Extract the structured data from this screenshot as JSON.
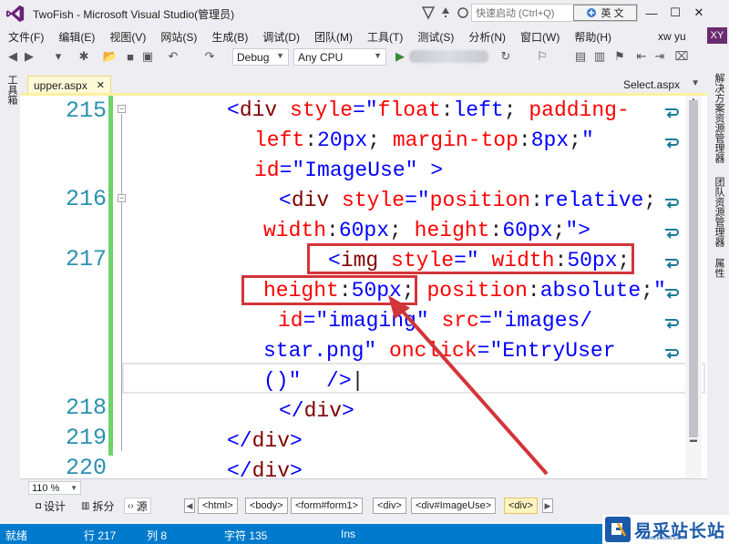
{
  "window": {
    "title": "TwoFish - Microsoft Visual Studio(管理员)",
    "quick_launch_placeholder": "快速启动 (Ctrl+Q)",
    "ime_label": "英 文"
  },
  "menu": [
    "文件(F)",
    "编辑(E)",
    "视图(V)",
    "网站(S)",
    "生成(B)",
    "调试(D)",
    "团队(M)",
    "工具(T)",
    "测试(S)",
    "分析(N)",
    "窗口(W)",
    "帮助(H)"
  ],
  "user": {
    "name": "xw yu",
    "initials": "XY"
  },
  "toolbar": {
    "config": "Debug",
    "platform": "Any CPU"
  },
  "left_panel": {
    "toolbox_label": "工具箱"
  },
  "right_panel": {
    "tabs": [
      "解决方案资源管理器",
      "团队资源管理器",
      "属性"
    ]
  },
  "tabs": {
    "active": "upper.aspx",
    "close_glyph": "✕",
    "preview": "Select.aspx"
  },
  "editor": {
    "line_numbers": [
      "215",
      "216",
      "217",
      "218",
      "219",
      "220"
    ],
    "zoom": "110 %"
  },
  "views": {
    "design": "设计",
    "split": "拆分",
    "source": "源"
  },
  "breadcrumb": [
    "<html>",
    "<body>",
    "<form#form1>",
    "<div>",
    "<div#ImageUse>",
    "<div>"
  ],
  "status": {
    "ready": "就绪",
    "row": "行 217",
    "col": "列 8",
    "char": "字符 135",
    "mode": "Ins"
  },
  "watermark": {
    "text": "易采站长站",
    "sub": "Www.Easck.Com"
  },
  "colors": {
    "accent": "#007acc",
    "highlight_red": "#d2353a",
    "change_green": "#6fd36b",
    "line_number": "#2b91af"
  }
}
